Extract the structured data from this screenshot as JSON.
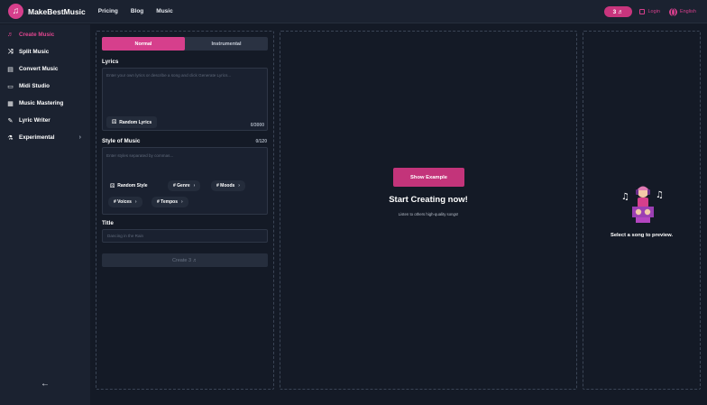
{
  "header": {
    "brand": "MakeBestMusic",
    "nav": [
      "Pricing",
      "Blog",
      "Music"
    ],
    "credits": "3 ♬",
    "login": "Login",
    "language": "English"
  },
  "sidebar": {
    "items": [
      {
        "label": "Create Music",
        "icon": "music-note-icon"
      },
      {
        "label": "Split Music",
        "icon": "split-icon"
      },
      {
        "label": "Convert Music",
        "icon": "convert-icon"
      },
      {
        "label": "Midi Studio",
        "icon": "midi-icon"
      },
      {
        "label": "Music Mastering",
        "icon": "mastering-icon"
      },
      {
        "label": "Lyric Writer",
        "icon": "lyric-icon"
      },
      {
        "label": "Experimental",
        "icon": "flask-icon"
      }
    ],
    "collapse": "←"
  },
  "form": {
    "modes": [
      "Normal",
      "Instrumental"
    ],
    "lyrics_label": "Lyrics",
    "lyrics_placeholder": "Enter your own lyrics or describe a song and click Generate Lyrics...",
    "random_lyrics": "Random Lyrics",
    "lyrics_count": "0/3000",
    "style_label": "Style of Music",
    "style_count": "0/120",
    "style_placeholder": "Enter styles separated by commas...",
    "random_style": "Random Style",
    "chips": [
      "# Genre",
      "# Moods",
      "# Voices",
      "# Tempos"
    ],
    "title_label": "Title",
    "title_placeholder": "Dancing in the Rain",
    "create": "Create 3 ♬"
  },
  "center": {
    "show_example": "Show Example",
    "heading": "Start Creating now!",
    "subtext": "Listen to others high-quality songs!"
  },
  "preview": {
    "text": "Select a song to preview."
  },
  "colors": {
    "accent": "#d63f8c",
    "background": "#141a26",
    "sidebar": "#1b2230"
  }
}
